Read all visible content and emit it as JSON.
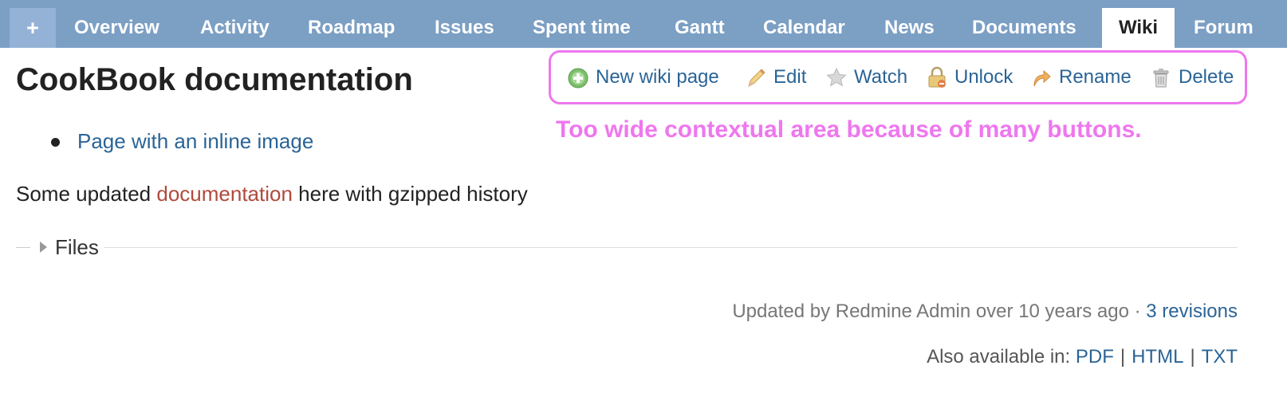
{
  "tabs": {
    "new_item": "+",
    "items": [
      {
        "label": "Overview"
      },
      {
        "label": "Activity"
      },
      {
        "label": "Roadmap"
      },
      {
        "label": "Issues"
      },
      {
        "label": "Spent time"
      },
      {
        "label": "Gantt"
      },
      {
        "label": "Calendar"
      },
      {
        "label": "News"
      },
      {
        "label": "Documents"
      },
      {
        "label": "Wiki",
        "selected": true
      },
      {
        "label": "Forum"
      }
    ]
  },
  "page": {
    "title": "CookBook documentation",
    "list_items": [
      "Page with an inline image"
    ],
    "paragraph": {
      "before": "Some updated ",
      "link": "documentation",
      "after": " here with gzipped history"
    },
    "files_label": "Files"
  },
  "contextual": {
    "new_wiki_page": {
      "label": "New wiki page",
      "icon": "add-icon"
    },
    "edit": {
      "label": "Edit",
      "icon": "pencil-icon"
    },
    "watch": {
      "label": "Watch",
      "icon": "star-icon"
    },
    "unlock": {
      "label": "Unlock",
      "icon": "lock-icon"
    },
    "rename": {
      "label": "Rename",
      "icon": "rename-arrow-icon"
    },
    "delete": {
      "label": "Delete",
      "icon": "trash-icon"
    }
  },
  "annotation": {
    "text": "Too wide contextual area because of many buttons.",
    "color": "#ee77ee"
  },
  "footer": {
    "updated_by": "Updated by Redmine Admin over 10 years ago · ",
    "revisions_link": "3 revisions",
    "also_available": "Also available in: ",
    "formats": [
      "PDF",
      "HTML",
      "TXT"
    ],
    "separator": "|"
  },
  "colors": {
    "tabbar": "#7c9fc4",
    "link": "#2a6496",
    "wiki_link": "#b04a3c"
  }
}
